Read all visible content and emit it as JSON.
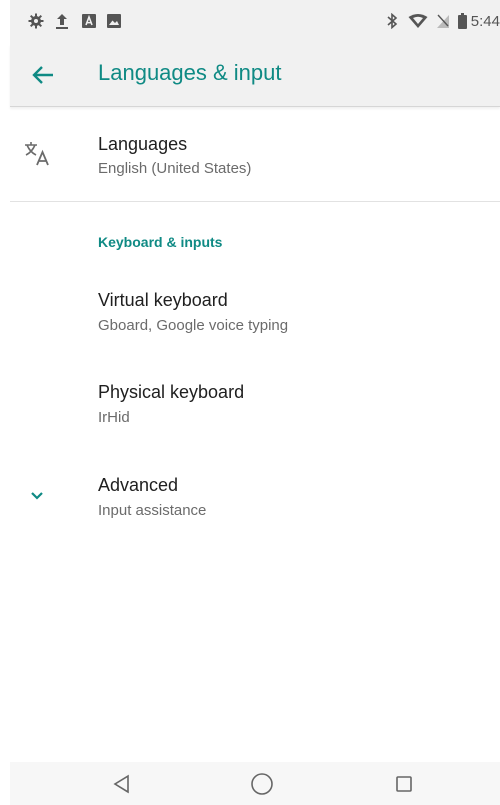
{
  "status_bar": {
    "time": "5:44",
    "left_icons": [
      "settings-gear-icon",
      "upload-arrow-icon",
      "image-a-icon",
      "image-icon"
    ],
    "right_icons": [
      "bluetooth-icon",
      "wifi-icon",
      "signal-icon",
      "battery-icon"
    ]
  },
  "toolbar": {
    "title": "Languages & input",
    "back_icon": "back-arrow-icon"
  },
  "languages": {
    "title": "Languages",
    "subtitle": "English (United States)",
    "icon": "translate-icon"
  },
  "section": {
    "header": "Keyboard & inputs"
  },
  "items": [
    {
      "title": "Virtual keyboard",
      "subtitle": "Gboard, Google voice typing"
    },
    {
      "title": "Physical keyboard",
      "subtitle": "IrHid"
    },
    {
      "title": "Advanced",
      "subtitle": "Input assistance",
      "icon": "chevron-down-icon"
    }
  ],
  "nav_bar": {
    "buttons": [
      "back-triangle-icon",
      "home-circle-icon",
      "recents-square-icon"
    ]
  },
  "colors": {
    "accent": "#0f8a84",
    "bar_background": "#f1f1f1",
    "text_primary": "#202020",
    "text_secondary": "#6b6b6b"
  }
}
